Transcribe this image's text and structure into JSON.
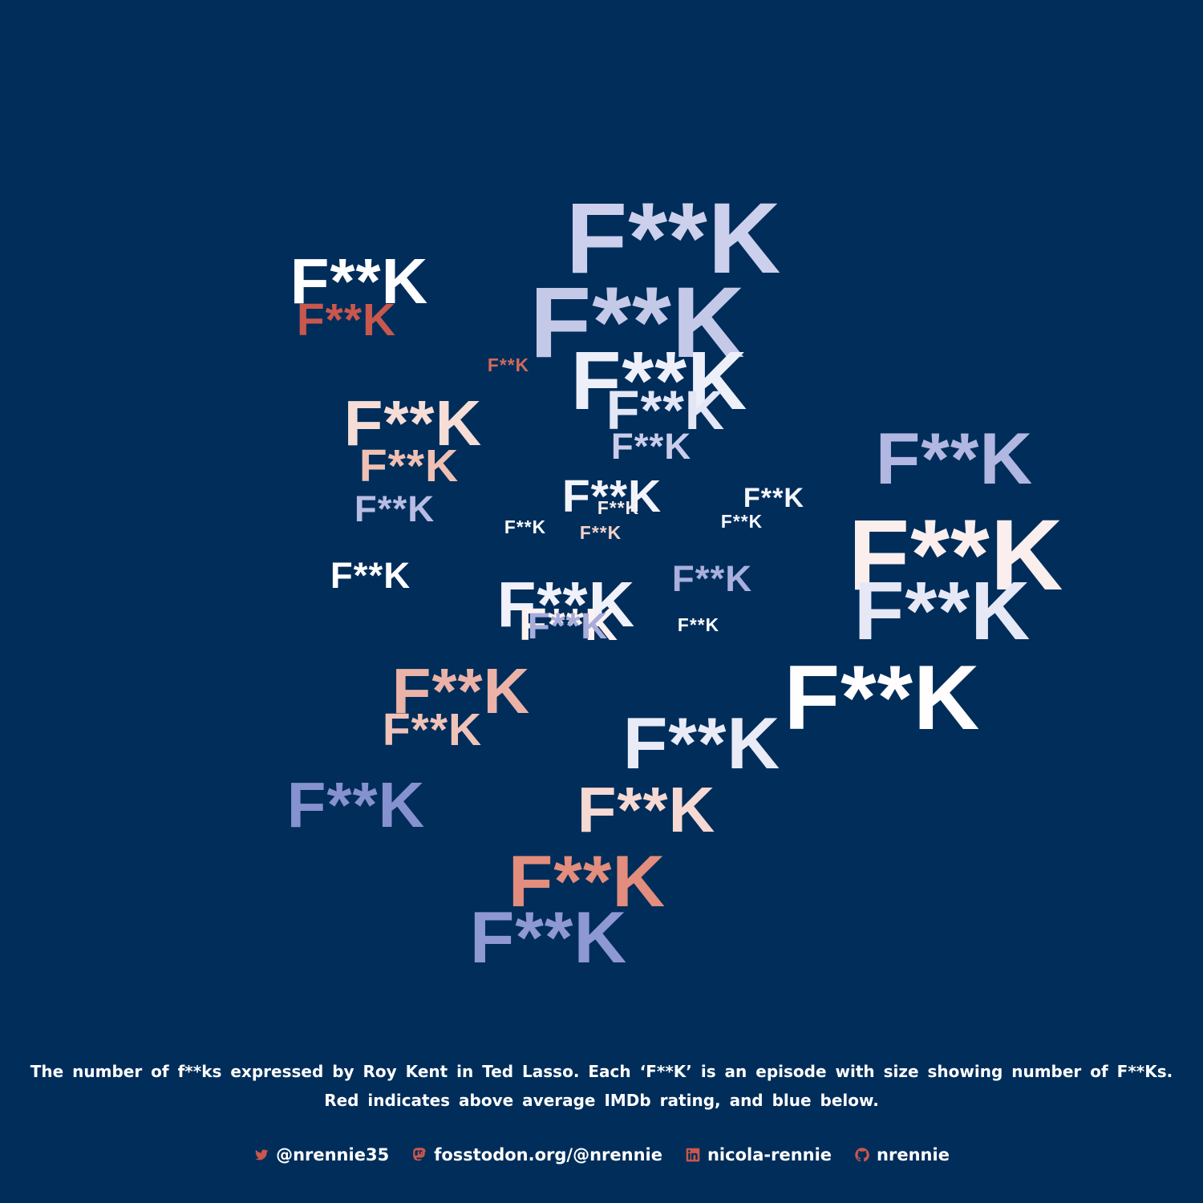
{
  "chart_data": {
    "type": "scatter",
    "mark_text": "F**K",
    "description_caption": "The number of f**ks expressed by Roy Kent in Ted Lasso. Each ‘F**K’ is an episode with size showing number of F**Ks. Red indicates above average IMDb rating, and blue below.",
    "colors": {
      "background": "#002d5a",
      "above_average": "#c8574e",
      "below_average": "#7f8ccc",
      "average": "#ffffff"
    },
    "episodes": [
      {
        "size": 11,
        "rating_class": "below",
        "color": "#cdd0ec"
      },
      {
        "size": 11,
        "rating_class": "below",
        "color": "#c5c9e8"
      },
      {
        "size": 7,
        "rating_class": "average",
        "color": "#ffffff"
      },
      {
        "size": 5,
        "rating_class": "above",
        "color": "#c8574e"
      },
      {
        "size": 2,
        "rating_class": "above",
        "color": "#d06a5c"
      },
      {
        "size": 9,
        "rating_class": "average",
        "color": "#eef0f9"
      },
      {
        "size": 6,
        "rating_class": "below",
        "color": "#e3e6f5"
      },
      {
        "size": 4,
        "rating_class": "below",
        "color": "#c9cdeb"
      },
      {
        "size": 7,
        "rating_class": "above",
        "color": "#f6ddd6"
      },
      {
        "size": 5,
        "rating_class": "above",
        "color": "#efc0b3"
      },
      {
        "size": 4,
        "rating_class": "below",
        "color": "#b8bde3"
      },
      {
        "size": 5,
        "rating_class": "average",
        "color": "#f3f4fb"
      },
      {
        "size": 2,
        "rating_class": "above",
        "color": "#fbecea"
      },
      {
        "size": 2,
        "rating_class": "average",
        "color": "#ffffff"
      },
      {
        "size": 2,
        "rating_class": "above",
        "color": "#f3d1c8"
      },
      {
        "size": 3,
        "rating_class": "average",
        "color": "#f5f6fc"
      },
      {
        "size": 2,
        "rating_class": "average",
        "color": "#f7f8fd"
      },
      {
        "size": 8,
        "rating_class": "below",
        "color": "#b1b7e0"
      },
      {
        "size": 11,
        "rating_class": "above",
        "color": "#fbefee"
      },
      {
        "size": 9,
        "rating_class": "below",
        "color": "#e6e8f6"
      },
      {
        "size": 4,
        "rating_class": "average",
        "color": "#ffffff"
      },
      {
        "size": 4,
        "rating_class": "below",
        "color": "#a9b0dd"
      },
      {
        "size": 7,
        "rating_class": "average",
        "color": "#f0f1fa"
      },
      {
        "size": 5,
        "rating_class": "above",
        "color": "#fdf2f0"
      },
      {
        "size": 4,
        "rating_class": "below",
        "color": "#a6addb"
      },
      {
        "size": 2,
        "rating_class": "average",
        "color": "#ffffff"
      },
      {
        "size": 10,
        "rating_class": "average",
        "color": "#fffdfd"
      },
      {
        "size": 7,
        "rating_class": "above",
        "color": "#ebb3a7"
      },
      {
        "size": 5,
        "rating_class": "above",
        "color": "#f0c3b8"
      },
      {
        "size": 8,
        "rating_class": "below",
        "color": "#e9ebf7"
      },
      {
        "size": 7,
        "rating_class": "below",
        "color": "#8691cf"
      },
      {
        "size": 7,
        "rating_class": "above",
        "color": "#f6d9d2"
      },
      {
        "size": 8,
        "rating_class": "above",
        "color": "#e28d7d"
      },
      {
        "size": 8,
        "rating_class": "below",
        "color": "#8e98d3"
      }
    ]
  },
  "caption": {
    "text": "The number of f**ks expressed by Roy Kent in Ted Lasso. Each ‘F**K’ is an episode with size showing number of F**Ks. Red indicates above average IMDb rating, and blue below."
  },
  "social": {
    "icon_color": "#c8574e",
    "items": [
      {
        "icon": "twitter-icon",
        "label": "@nrennie35"
      },
      {
        "icon": "mastodon-icon",
        "label": "fosstodon.org/@nrennie"
      },
      {
        "icon": "linkedin-icon",
        "label": "nicola-rennie"
      },
      {
        "icon": "github-icon",
        "label": "nrennie"
      }
    ]
  }
}
